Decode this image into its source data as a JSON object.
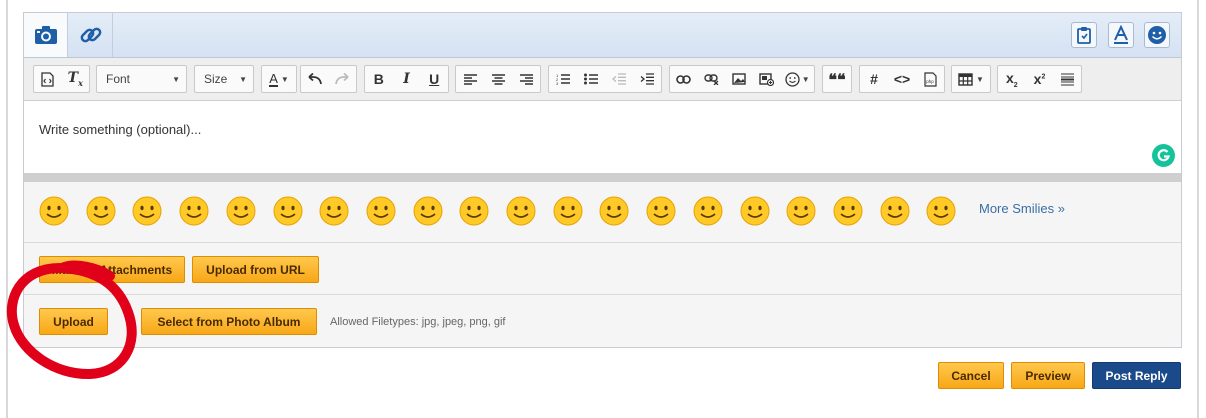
{
  "editor": {
    "placeholder": "Write something (optional)...",
    "tabs": [
      "camera-icon",
      "link-icon"
    ],
    "right_icons": [
      "clipboard-icon",
      "text-format-icon",
      "smiley-icon"
    ],
    "toolbar": {
      "font_label": "Font",
      "size_label": "Size",
      "bold_label": "B",
      "italic_label": "I",
      "underline_label": "U",
      "hash_label": "#",
      "code_label": "<>",
      "blockquote_label": "❝❝"
    }
  },
  "smilies": {
    "items": [
      "😊",
      "😇",
      "🙂",
      "🙃",
      "😉",
      "😀",
      "😃",
      "😄",
      "😁",
      "😆",
      "😅",
      "😂",
      "🤣",
      "☺️",
      "😌",
      "😍",
      "😘",
      "😗",
      "😚",
      "😋"
    ],
    "more_label": "More Smilies »"
  },
  "attachments": {
    "manage_label": "Manage Attachments",
    "upload_url_label": "Upload from URL",
    "upload_label": "Upload",
    "photo_album_label": "Select from Photo Album",
    "allowed_filetypes": "Allowed Filetypes: jpg, jpeg, png, gif"
  },
  "actions": {
    "cancel_label": "Cancel",
    "preview_label": "Preview",
    "post_reply_label": "Post Reply"
  },
  "colors": {
    "orange_button": "#f8a717",
    "primary_blue": "#1a4a8a",
    "link_blue": "#3b6ea5",
    "annotation_red": "#e0001a",
    "grammarly_green": "#15c39a"
  }
}
